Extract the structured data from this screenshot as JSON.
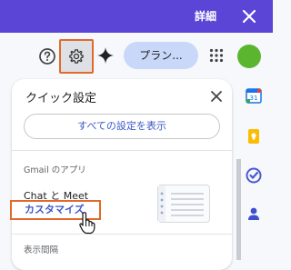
{
  "topbar": {
    "detail_label": "詳細",
    "close_icon": "close-icon"
  },
  "toolbar": {
    "help_icon": "help-icon",
    "settings_icon": "gear-icon",
    "gemini_icon": "sparkle-icon",
    "plan_button_label": "プラン...",
    "apps_icon": "apps-grid-icon",
    "avatar_color": "#5cb52e"
  },
  "panel": {
    "title": "クイック設定",
    "all_settings_label": "すべての設定を表示",
    "section_title": "Gmail のアプリ",
    "chat_meet_label": "Chat と Meet",
    "customize_label": "カスタマイズ",
    "section2_title": "表示間隔"
  },
  "colors": {
    "accent": "#5b45d6",
    "highlight": "#e2692a",
    "link": "#3a58c8"
  }
}
